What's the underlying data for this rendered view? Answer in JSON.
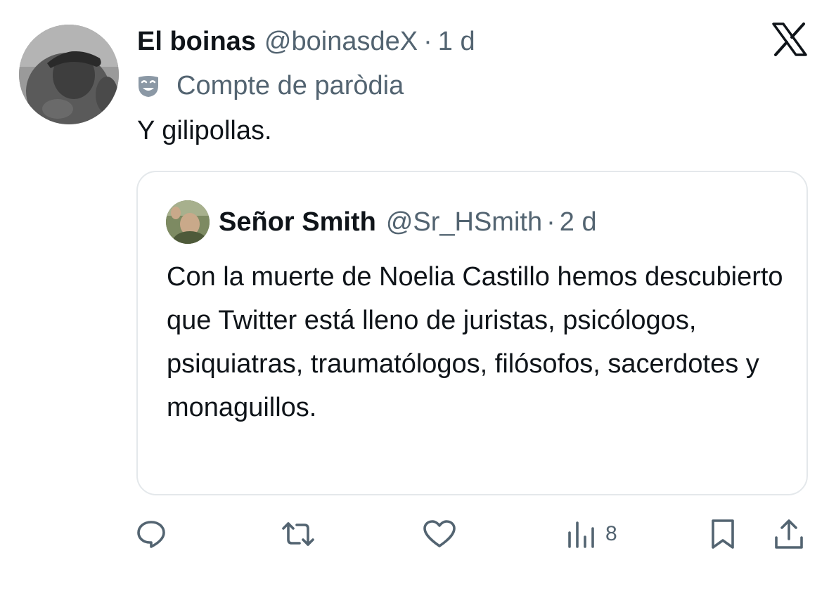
{
  "author": {
    "display_name": "El boinas",
    "handle": "@boinasdeX",
    "separator": "·",
    "time": "1 d",
    "label_icon": "parody-mask-icon",
    "label_text": "Compte de paròdia"
  },
  "tweet": {
    "text": "Y gilipollas."
  },
  "quote": {
    "display_name": "Señor Smith",
    "handle": "@Sr_HSmith",
    "separator": "·",
    "time": "2 d",
    "text": "Con la muerte de Noelia Castillo hemos descubierto que Twitter está lleno de juristas, psicólogos, psiquiatras, traumatólogos, filósofos, sacerdotes y monaguillos."
  },
  "actions": {
    "reply_icon": "reply-icon",
    "retweet_icon": "retweet-icon",
    "like_icon": "like-heart-icon",
    "views_icon": "views-bar-chart-icon",
    "views_count": "8",
    "bookmark_icon": "bookmark-icon",
    "share_icon": "share-icon"
  },
  "brand": {
    "logo": "x-logo",
    "text_color": "#0f1419",
    "secondary_color": "#536471",
    "border_color": "#e4e8eb"
  }
}
